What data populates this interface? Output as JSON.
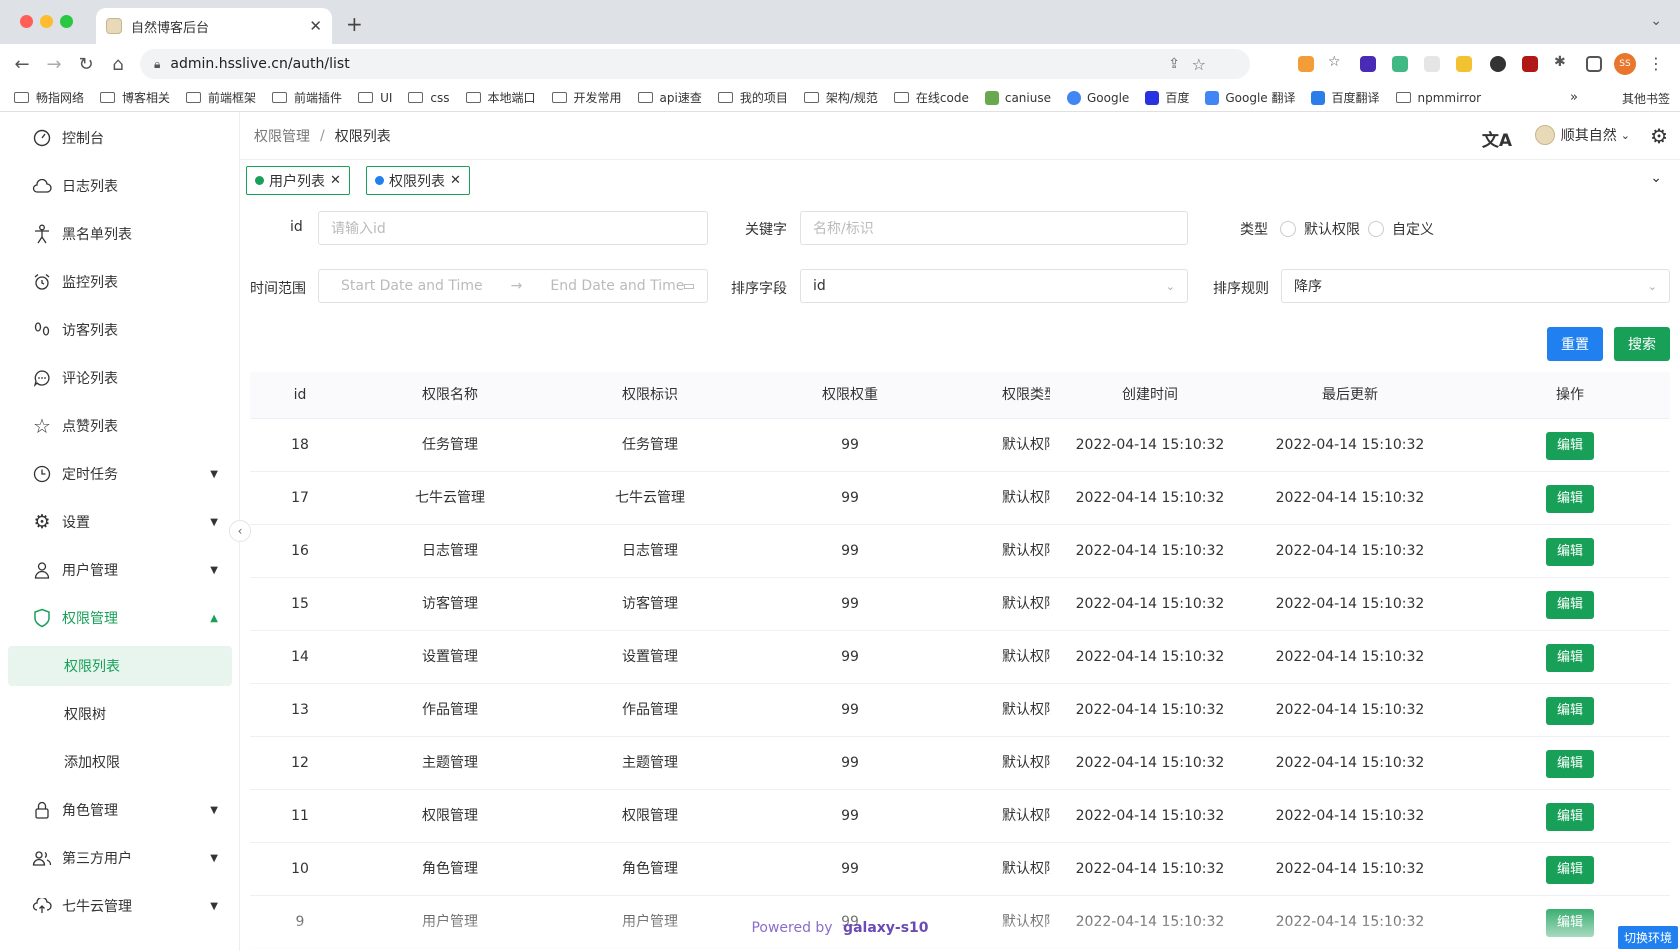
{
  "browser": {
    "tab_title": "自然博客后台",
    "url": "admin.hsslive.cn/auth/list",
    "bookmarks": [
      "畅指网络",
      "博客相关",
      "前端框架",
      "前端插件",
      "UI",
      "css",
      "本地端口",
      "开发常用",
      "api速查",
      "我的项目",
      "架构/规范",
      "在线code",
      "caniuse",
      "Google",
      "百度",
      "Google 翻译",
      "百度翻译",
      "npmmirror"
    ],
    "bookmarks_more": "»",
    "bookmarks_other": "其他书签",
    "profile_initials": "SS"
  },
  "sidebar": {
    "items": [
      {
        "label": "控制台",
        "icon": "dashboard-icon"
      },
      {
        "label": "日志列表",
        "icon": "cloud-icon"
      },
      {
        "label": "黑名单列表",
        "icon": "person-icon"
      },
      {
        "label": "监控列表",
        "icon": "alarm-icon"
      },
      {
        "label": "访客列表",
        "icon": "footprint-icon"
      },
      {
        "label": "评论列表",
        "icon": "comment-icon"
      },
      {
        "label": "点赞列表",
        "icon": "star-icon"
      },
      {
        "label": "定时任务",
        "icon": "clock-icon"
      },
      {
        "label": "设置",
        "icon": "gear-icon"
      },
      {
        "label": "用户管理",
        "icon": "user-icon"
      },
      {
        "label": "权限管理",
        "icon": "shield-icon"
      },
      {
        "label": "角色管理",
        "icon": "lock-icon"
      },
      {
        "label": "第三方用户",
        "icon": "users-icon"
      },
      {
        "label": "七牛云管理",
        "icon": "cloud-upload-icon"
      }
    ],
    "sub_items": [
      "权限列表",
      "权限树",
      "添加权限"
    ]
  },
  "header": {
    "breadcrumb": [
      "权限管理",
      "权限列表"
    ],
    "username": "顺其自然"
  },
  "tags": [
    {
      "label": "用户列表",
      "dot_color": "#18a058"
    },
    {
      "label": "权限列表",
      "dot_color": "#2080f0"
    }
  ],
  "filters": {
    "id_label": "id",
    "id_placeholder": "请输入id",
    "keyword_label": "关键字",
    "keyword_placeholder": "名称/标识",
    "type_label": "类型",
    "type_options": [
      "默认权限",
      "自定义"
    ],
    "time_label": "时间范围",
    "start_placeholder": "Start Date and Time",
    "end_placeholder": "End Date and Time",
    "sort_field_label": "排序字段",
    "sort_field_value": "id",
    "sort_rule_label": "排序规则",
    "sort_rule_value": "降序",
    "reset_label": "重置",
    "search_label": "搜索"
  },
  "table": {
    "columns": [
      "id",
      "权限名称",
      "权限标识",
      "权限权重",
      "权限类型",
      "创建时间",
      "最后更新",
      "操作"
    ],
    "edit_label": "编辑",
    "rows": [
      {
        "id": "18",
        "name": "任务管理",
        "key": "任务管理",
        "weight": "99",
        "type": "默认权限",
        "created": "2022-04-14 15:10:32",
        "updated": "2022-04-14 15:10:32"
      },
      {
        "id": "17",
        "name": "七牛云管理",
        "key": "七牛云管理",
        "weight": "99",
        "type": "默认权限",
        "created": "2022-04-14 15:10:32",
        "updated": "2022-04-14 15:10:32"
      },
      {
        "id": "16",
        "name": "日志管理",
        "key": "日志管理",
        "weight": "99",
        "type": "默认权限",
        "created": "2022-04-14 15:10:32",
        "updated": "2022-04-14 15:10:32"
      },
      {
        "id": "15",
        "name": "访客管理",
        "key": "访客管理",
        "weight": "99",
        "type": "默认权限",
        "created": "2022-04-14 15:10:32",
        "updated": "2022-04-14 15:10:32"
      },
      {
        "id": "14",
        "name": "设置管理",
        "key": "设置管理",
        "weight": "99",
        "type": "默认权限",
        "created": "2022-04-14 15:10:32",
        "updated": "2022-04-14 15:10:32"
      },
      {
        "id": "13",
        "name": "作品管理",
        "key": "作品管理",
        "weight": "99",
        "type": "默认权限",
        "created": "2022-04-14 15:10:32",
        "updated": "2022-04-14 15:10:32"
      },
      {
        "id": "12",
        "name": "主题管理",
        "key": "主题管理",
        "weight": "99",
        "type": "默认权限",
        "created": "2022-04-14 15:10:32",
        "updated": "2022-04-14 15:10:32"
      },
      {
        "id": "11",
        "name": "权限管理",
        "key": "权限管理",
        "weight": "99",
        "type": "默认权限",
        "created": "2022-04-14 15:10:32",
        "updated": "2022-04-14 15:10:32"
      },
      {
        "id": "10",
        "name": "角色管理",
        "key": "角色管理",
        "weight": "99",
        "type": "默认权限",
        "created": "2022-04-14 15:10:32",
        "updated": "2022-04-14 15:10:32"
      },
      {
        "id": "9",
        "name": "用户管理",
        "key": "用户管理",
        "weight": "99",
        "type": "默认权限",
        "created": "2022-04-14 15:10:32",
        "updated": "2022-04-14 15:10:32"
      }
    ]
  },
  "footer": {
    "powered_by": "Powered by",
    "brand": "galaxy-s10"
  },
  "switch_env": "切换环境",
  "colors": {
    "primary": "#18a058",
    "info": "#2080f0"
  }
}
